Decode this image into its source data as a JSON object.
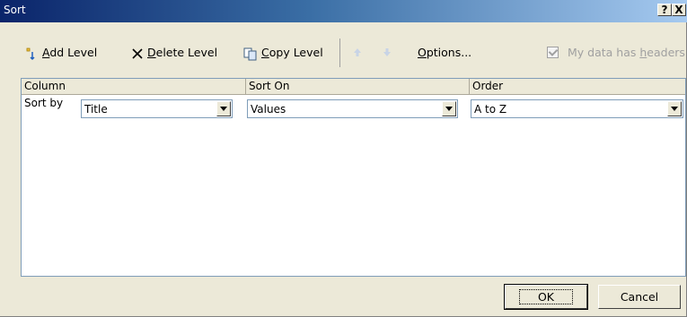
{
  "window": {
    "title": "Sort",
    "help": "?",
    "close": "X"
  },
  "toolbar": {
    "add_prefix": "",
    "add_accel": "A",
    "add_rest": "dd Level",
    "delete_accel": "D",
    "delete_rest": "elete Level",
    "copy_accel": "C",
    "copy_rest": "opy Level",
    "options_accel": "O",
    "options_rest": "ptions...",
    "headers_pre": "My data has ",
    "headers_accel": "h",
    "headers_rest": "eaders"
  },
  "grid": {
    "columns": [
      "Column",
      "Sort On",
      "Order"
    ],
    "rows": [
      {
        "label": "Sort by",
        "column": "Title",
        "sort_on": "Values",
        "order": "A to Z"
      }
    ]
  },
  "buttons": {
    "ok": "OK",
    "cancel": "Cancel"
  }
}
